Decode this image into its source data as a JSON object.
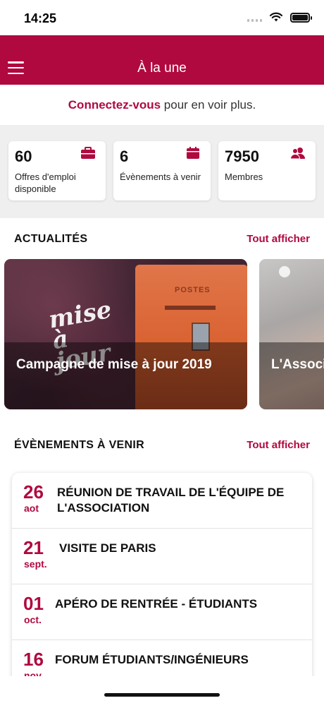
{
  "status_bar": {
    "time": "14:25"
  },
  "header": {
    "title": "À la une"
  },
  "login_prompt": {
    "link": "Connectez-vous",
    "rest": " pour en voir plus."
  },
  "stats": [
    {
      "value": "60",
      "label": "Offres d'emploi disponible",
      "icon": "briefcase-icon"
    },
    {
      "value": "6",
      "label": "Évènements à venir",
      "icon": "calendar-icon"
    },
    {
      "value": "7950",
      "label": "Membres",
      "icon": "members-icon"
    }
  ],
  "news": {
    "title": "ACTUALITÉS",
    "see_all": "Tout afficher",
    "items": [
      {
        "title": "Campagne de mise à jour 2019",
        "image_text": "mise à jour",
        "image_sign": "POSTES"
      },
      {
        "title": "L'Associ"
      }
    ]
  },
  "events": {
    "title": "ÉVÈNEMENTS À VENIR",
    "see_all": "Tout afficher",
    "items": [
      {
        "day": "26",
        "month": "aot",
        "title": "RÉUNION DE TRAVAIL DE L'ÉQUIPE DE L'ASSOCIATION"
      },
      {
        "day": "21",
        "month": "sept.",
        "title": "VISITE DE PARIS"
      },
      {
        "day": "01",
        "month": "oct.",
        "title": "APÉRO DE RENTRÉE - ÉTUDIANTS"
      },
      {
        "day": "16",
        "month": "nov.",
        "title": "FORUM ÉTUDIANTS/INGÉNIEURS"
      }
    ]
  },
  "colors": {
    "brand": "#b0093f",
    "background_grey": "#efeff0"
  }
}
